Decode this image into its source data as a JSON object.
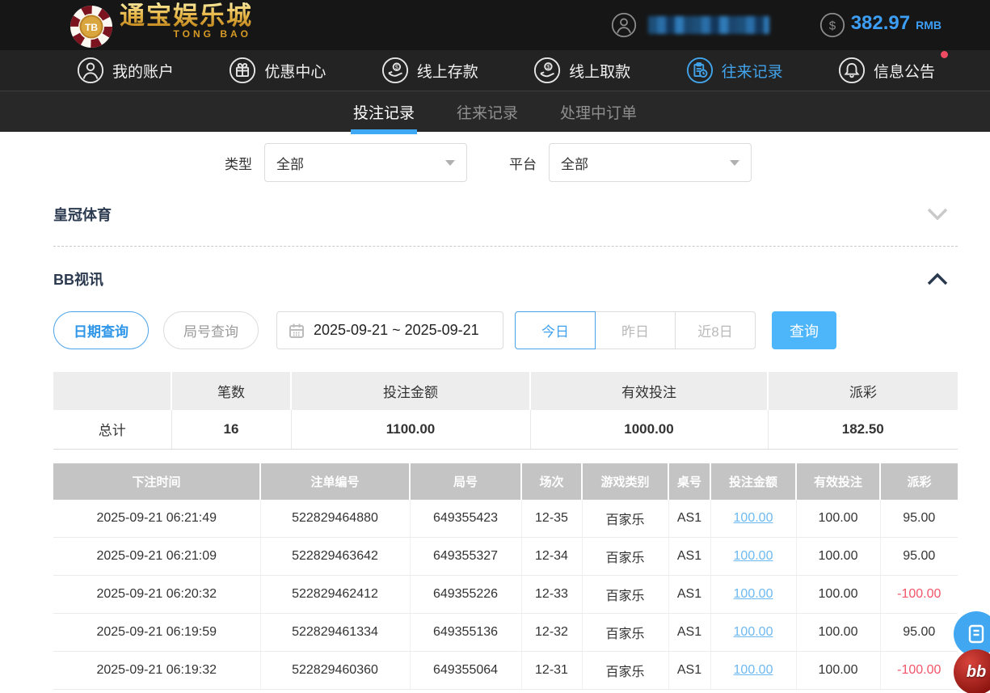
{
  "topbar": {
    "logo": {
      "chip_text": "TB",
      "title": "通宝娱乐城",
      "subtitle": "TONG BAO"
    },
    "balance": {
      "amount": "382.97",
      "currency": "RMB"
    }
  },
  "nav": {
    "items": [
      {
        "label": "我的账户",
        "icon": "user-icon",
        "active": false
      },
      {
        "label": "优惠中心",
        "icon": "gift-icon",
        "active": false
      },
      {
        "label": "线上存款",
        "icon": "deposit-icon",
        "active": false
      },
      {
        "label": "线上取款",
        "icon": "withdraw-icon",
        "active": false
      },
      {
        "label": "往来记录",
        "icon": "records-icon",
        "active": true
      },
      {
        "label": "信息公告",
        "icon": "bell-icon",
        "active": false,
        "badge": true
      }
    ]
  },
  "tabs": [
    {
      "label": "投注记录",
      "active": true
    },
    {
      "label": "往来记录",
      "active": false
    },
    {
      "label": "处理中订单",
      "active": false
    }
  ],
  "filters": {
    "type_label": "类型",
    "type_value": "全部",
    "platform_label": "平台",
    "platform_value": "全部"
  },
  "sections": {
    "crown": {
      "title": "皇冠体育",
      "collapsed": true
    },
    "bb": {
      "title": "BB视讯",
      "collapsed": false
    }
  },
  "query": {
    "date_query": "日期查询",
    "round_query": "局号查询",
    "date_range": "2025-09-21 ~ 2025-09-21",
    "today": "今日",
    "yesterday": "昨日",
    "last8days": "近8日",
    "search": "查询"
  },
  "summary": {
    "headers": [
      "",
      "笔数",
      "投注金额",
      "有效投注",
      "派彩"
    ],
    "row_label": "总计",
    "values": [
      "16",
      "1100.00",
      "1000.00",
      "182.50"
    ]
  },
  "table": {
    "headers": [
      "下注时间",
      "注单编号",
      "局号",
      "场次",
      "游戏类别",
      "桌号",
      "投注金额",
      "有效投注",
      "派彩"
    ],
    "rows": [
      {
        "time": "2025-09-21 06:21:49",
        "bet_id": "522829464880",
        "round": "649355423",
        "session": "12-35",
        "game": "百家乐",
        "table_no": "AS1",
        "amount": "100.00",
        "valid": "100.00",
        "payout": "95.00"
      },
      {
        "time": "2025-09-21 06:21:09",
        "bet_id": "522829463642",
        "round": "649355327",
        "session": "12-34",
        "game": "百家乐",
        "table_no": "AS1",
        "amount": "100.00",
        "valid": "100.00",
        "payout": "95.00"
      },
      {
        "time": "2025-09-21 06:20:32",
        "bet_id": "522829462412",
        "round": "649355226",
        "session": "12-33",
        "game": "百家乐",
        "table_no": "AS1",
        "amount": "100.00",
        "valid": "100.00",
        "payout": "-100.00"
      },
      {
        "time": "2025-09-21 06:19:59",
        "bet_id": "522829461334",
        "round": "649355136",
        "session": "12-32",
        "game": "百家乐",
        "table_no": "AS1",
        "amount": "100.00",
        "valid": "100.00",
        "payout": "95.00"
      },
      {
        "time": "2025-09-21 06:19:32",
        "bet_id": "522829460360",
        "round": "649355064",
        "session": "12-31",
        "game": "百家乐",
        "table_no": "AS1",
        "amount": "100.00",
        "valid": "100.00",
        "payout": "-100.00"
      }
    ]
  },
  "floating": {
    "bb_label": "bb"
  }
}
